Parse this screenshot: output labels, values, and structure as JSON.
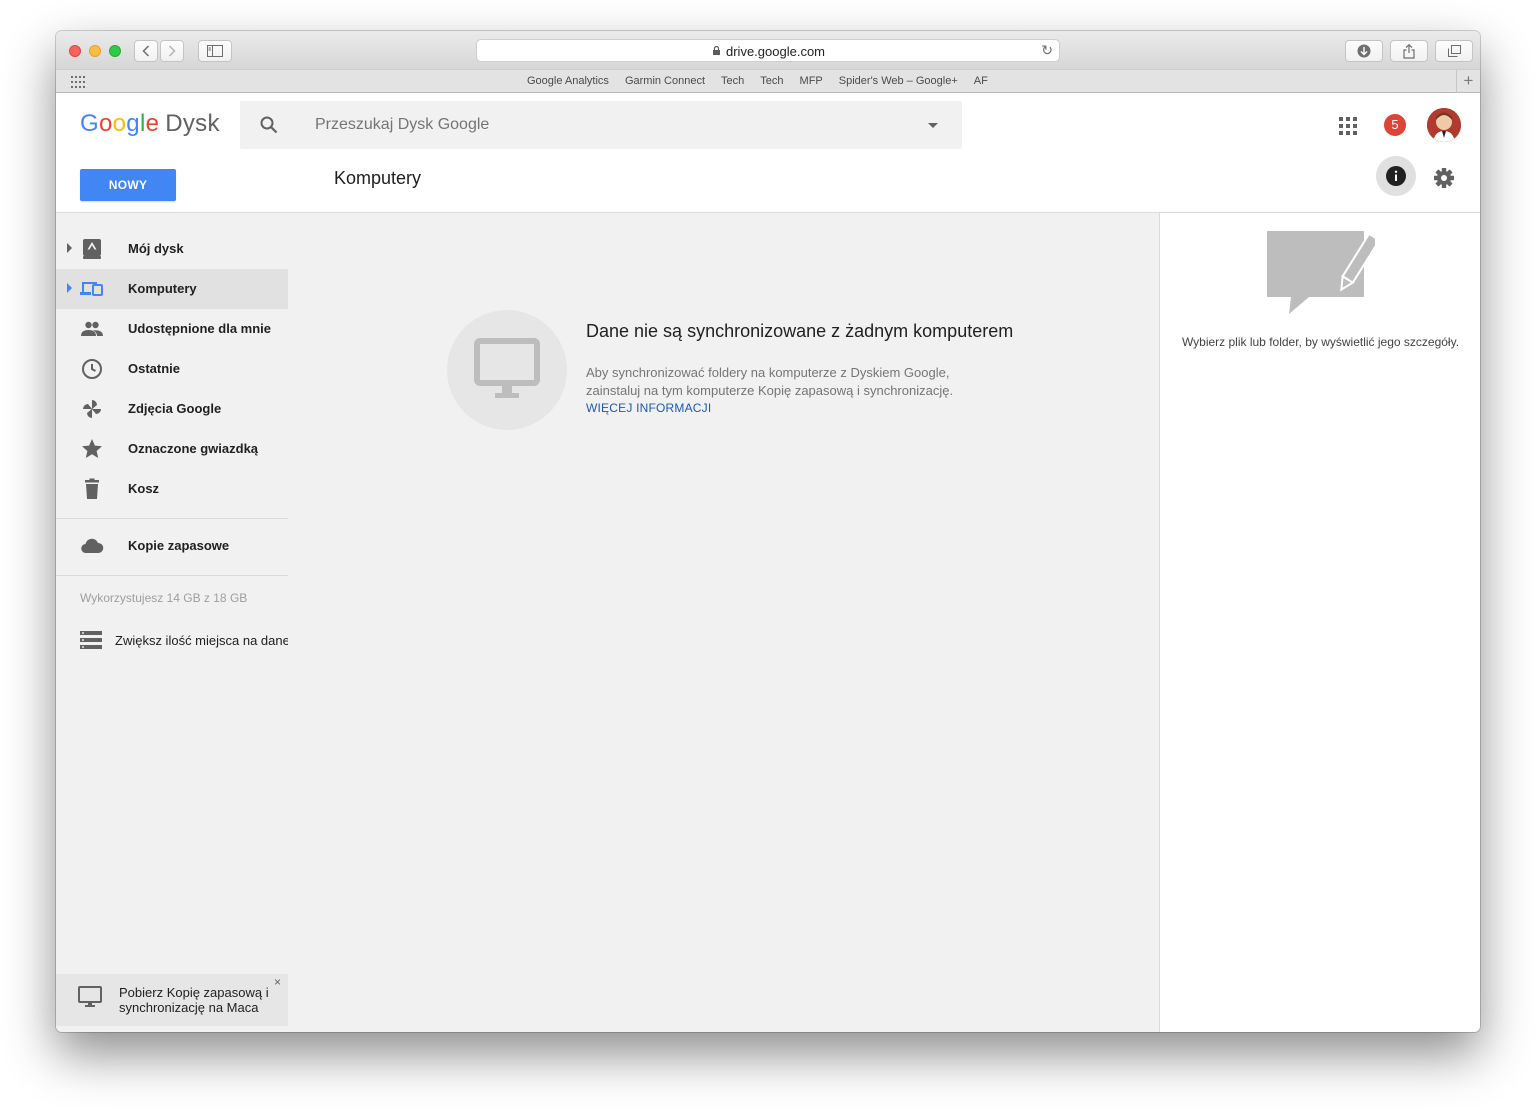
{
  "browser": {
    "url": "drive.google.com",
    "bookmarks": [
      "Google Analytics",
      "Garmin Connect",
      "Tech",
      "Tech",
      "MFP",
      "Spider's Web – Google+",
      "AF"
    ]
  },
  "header": {
    "logo_google": "Google",
    "logo_product": "Dysk",
    "search_placeholder": "Przeszukaj Dysk Google",
    "notification_count": "5",
    "new_button": "NOWY",
    "page_title": "Komputery"
  },
  "sidebar": {
    "items": [
      {
        "label": "Mój dysk",
        "icon": "my-drive-icon"
      },
      {
        "label": "Komputery",
        "icon": "computers-icon"
      },
      {
        "label": "Udostępnione dla mnie",
        "icon": "people-icon"
      },
      {
        "label": "Ostatnie",
        "icon": "clock-icon"
      },
      {
        "label": "Zdjęcia Google",
        "icon": "pinwheel-icon"
      },
      {
        "label": "Oznaczone gwiazdką",
        "icon": "star-icon"
      },
      {
        "label": "Kosz",
        "icon": "trash-icon"
      }
    ],
    "backups": {
      "label": "Kopie zapasowe",
      "icon": "cloud-icon"
    },
    "storage_text": "Wykorzystujesz 14 GB z 18 GB",
    "upgrade_label": "Zwiększ ilość miejsca na dane",
    "promo_text": "Pobierz Kopię zapasową i synchronizację na Maca",
    "promo_close": "×"
  },
  "main": {
    "empty_title": "Dane nie są synchronizowane z żadnym komputerem",
    "empty_desc": "Aby synchronizować foldery na komputerze z Dyskiem Google, zainstaluj na tym komputerze Kopię zapasową i synchronizację.",
    "more_link": "WIĘCEJ INFORMACJI"
  },
  "details": {
    "hint": "Wybierz plik lub folder, by wyświetlić jego szczegóły."
  },
  "colors": {
    "accent": "#4285f4",
    "notification": "#db4437",
    "link": "#1a58b8",
    "sidebar_bg": "#f1f1f1",
    "active_bg": "#e1e1e1"
  }
}
